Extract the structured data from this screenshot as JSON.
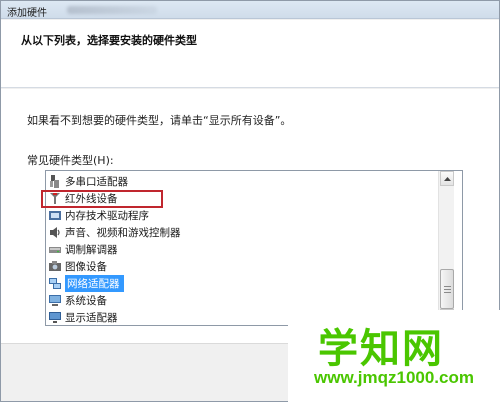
{
  "window": {
    "title": "添加硬件"
  },
  "header": {
    "title": "从以下列表，选择要安装的硬件类型"
  },
  "body": {
    "instruction": "如果看不到想要的硬件类型，请单击“显示所有设备”。",
    "list_label": "常见硬件类型(H):"
  },
  "hardware_list": {
    "items": [
      {
        "label": "多串口适配器",
        "icon": "multiport-adapter-icon"
      },
      {
        "label": "红外线设备",
        "icon": "infrared-device-icon"
      },
      {
        "label": "内存技术驱动程序",
        "icon": "memory-driver-icon"
      },
      {
        "label": "声音、视频和游戏控制器",
        "icon": "sound-video-icon"
      },
      {
        "label": "调制解调器",
        "icon": "modem-icon"
      },
      {
        "label": "图像设备",
        "icon": "imaging-device-icon"
      },
      {
        "label": "网络适配器",
        "icon": "network-adapter-icon",
        "selected": true
      },
      {
        "label": "系统设备",
        "icon": "system-device-icon"
      },
      {
        "label": "显示适配器",
        "icon": "display-adapter-icon"
      }
    ]
  },
  "watermark": {
    "text": "学知网",
    "url": "www.jmqz1000.com"
  },
  "colors": {
    "selection": "#3399ff",
    "highlight_border": "#c0262e",
    "watermark": "#4ac600"
  }
}
